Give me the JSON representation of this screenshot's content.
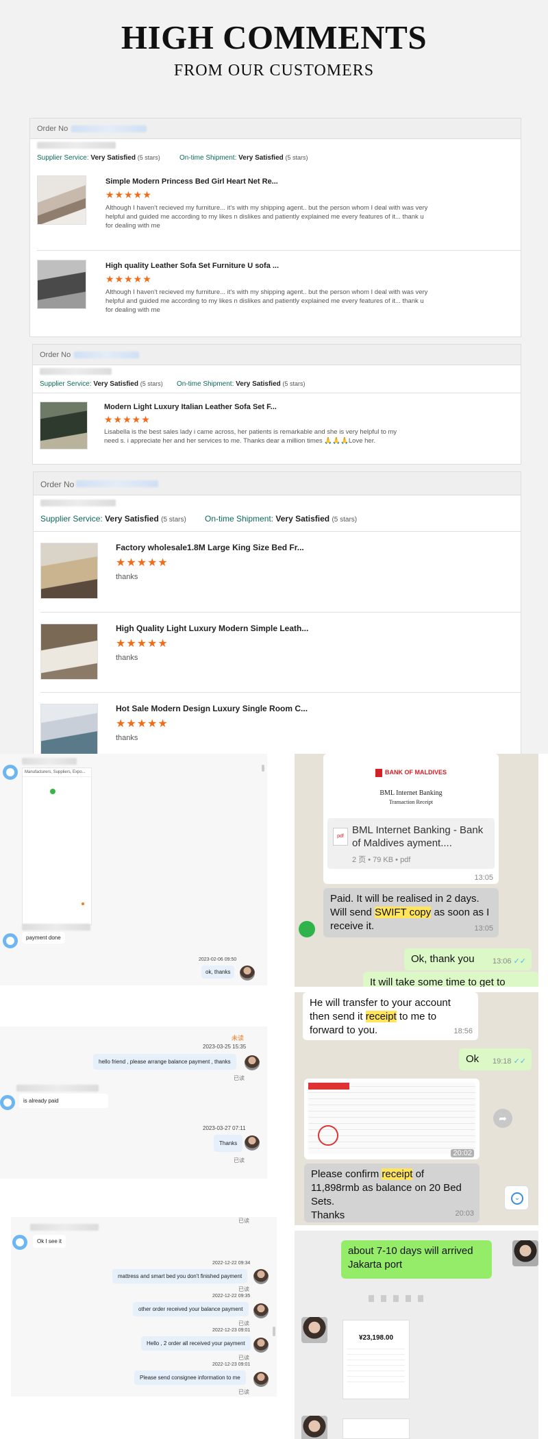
{
  "header": {
    "title": "HIGH COMMENTS",
    "subtitle": "FROM OUR CUSTOMERS"
  },
  "order_label": "Order No",
  "supplier_service_label": "Supplier Service:",
  "shipment_label": "On-time Shipment:",
  "satisfied": "Very Satisfied",
  "five_stars": "(5 stars)",
  "stars": "★★★★★",
  "orders": [
    {
      "items": [
        {
          "title": "Simple Modern Princess Bed Girl Heart Net Re...",
          "text": "Although I haven't recieved my furniture... it's with my shipping agent.. but the person whom I deal with was very helpful and guided me according to my likes n dislikes and patiently explained me every features of it... thank u for dealing with me"
        },
        {
          "title": "High quality Leather Sofa Set Furniture U sofa ...",
          "text": "Although I haven't recieved my furniture... it's with my shipping agent.. but the person whom I deal with was very helpful and guided me according to my likes n dislikes and patiently explained me every features of it... thank u for dealing with me"
        }
      ]
    },
    {
      "items": [
        {
          "title": "Modern Light Luxury Italian Leather Sofa Set F...",
          "text": "Lisabella is the best sales lady i came across, her patients is remarkable and she is very helpful to my need s. i appreciate her and her services to me. Thanks dear a million times 🙏🙏🙏Love her."
        }
      ]
    },
    {
      "items": [
        {
          "title": "Factory wholesale1.8M Large King Size Bed Fr...",
          "text": "thanks"
        },
        {
          "title": "High Quality Light Luxury Modern Simple Leath...",
          "text": "thanks"
        },
        {
          "title": "Hot Sale Modern Design Luxury Single Room C...",
          "text": "thanks"
        }
      ]
    }
  ],
  "chat1": {
    "preview_title": "Manufacturers, Suppliers, Expo...",
    "payment_msg": "payment done",
    "ts": "2023-02-06 09:50",
    "reply": "ok, thanks"
  },
  "chat2": {
    "unread": "未读",
    "ts1": "2023-03-25 15:35",
    "msg1": "hello friend , please arrange balance payment , thanks",
    "read": "已读",
    "them": "is already paid",
    "ts2": "2023-03-27 07:11",
    "msg2": "Thanks"
  },
  "chat3": {
    "them": "Ok I see it",
    "messages": [
      {
        "ts": "2022-12-22 09:34",
        "text": "mattress and smart bed you don't finished payment"
      },
      {
        "ts": "2022-12-22 09:35",
        "text": "other order received your balance payment"
      },
      {
        "ts": "2022-12-23 09:01",
        "text": "Hello , 2 order all received your payment"
      },
      {
        "ts": "2022-12-23 09:01",
        "text": "Please send consignee information to me"
      }
    ],
    "read": "已读"
  },
  "wa1": {
    "bank_name": "BANK OF MALDIVES",
    "bank_sub1": "BML Internet Banking",
    "bank_sub2": "Transaction Receipt",
    "file_icon": "pdf",
    "file_title": "BML Internet Banking - Bank of Maldives ayment....",
    "file_meta": "2 页 • 79 KB • pdf",
    "t1": "13:05",
    "msg_a1": "Paid. It will be realised in 2 days. Will send ",
    "msg_hl": "SWIFT copy",
    "msg_a2": " as soon as I receive it.",
    "t2": "13:05",
    "reply": "Ok, thank you",
    "t3": "13:06",
    "cut": "It will take some time to get to"
  },
  "wa2": {
    "msg1a": "He will transfer to your account then send it ",
    "msg1hl": "receipt",
    "msg1b": " to me to forward to you.",
    "t1": "18:56",
    "ok": "Ok",
    "t2": "19:18",
    "t3": "20:02",
    "msg2a": "Please confirm ",
    "msg2hl": "receipt",
    "msg2b": " of 11,898rmb as balance on 20 Bed Sets.",
    "msg2c": "Thanks",
    "t4": "20:03"
  },
  "wa3": {
    "msg": "about 7-10 days will arrived Jakarta port",
    "amount": "¥23,198.00"
  },
  "colors": {
    "star": "#f26b16",
    "wa_green": "#95ec69",
    "highlight": "#ffe45c",
    "chat_me": "#e6f0fb"
  }
}
